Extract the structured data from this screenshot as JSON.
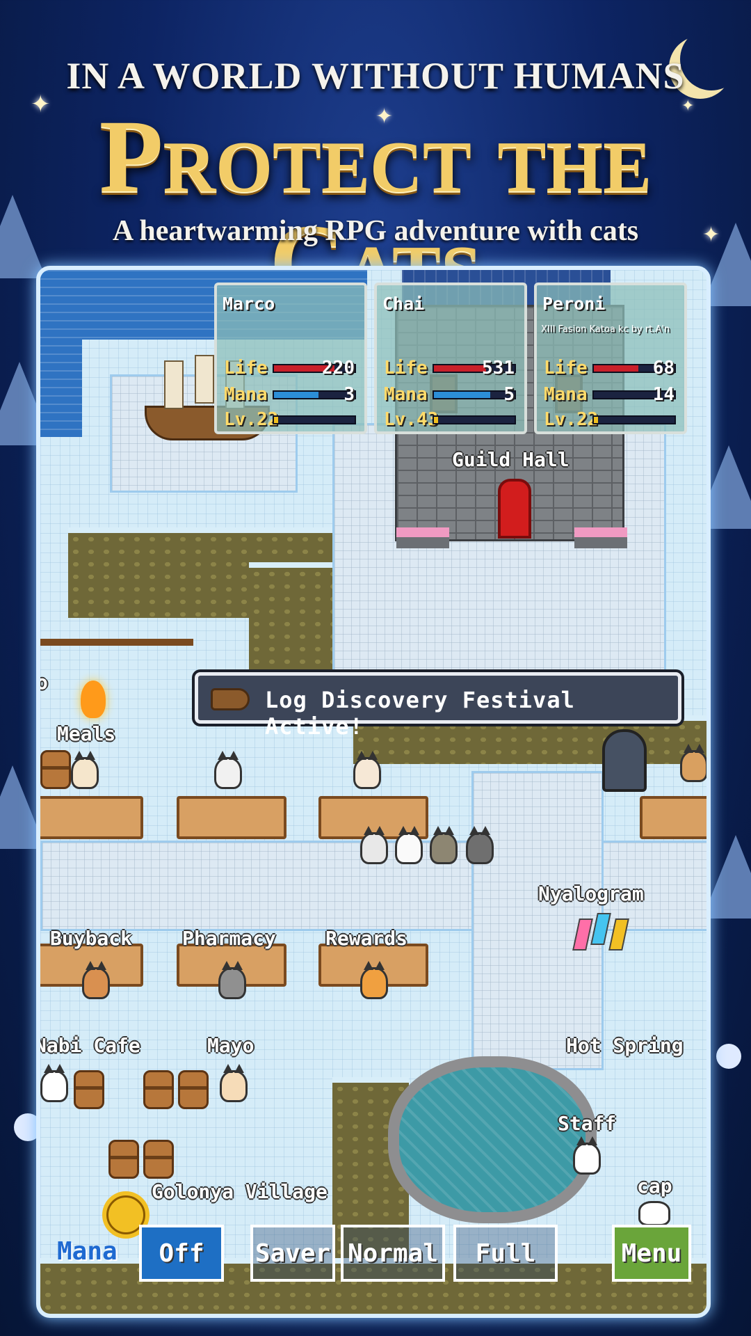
{
  "promo": {
    "headline": "IN A WORLD WITHOUT HUMANS",
    "title": "Protect the Cats",
    "subtitle": "A heartwarming RPG adventure with cats"
  },
  "party": [
    {
      "name": "Marco",
      "subtitle": "",
      "life": "220",
      "mana": "3",
      "level": "Lv.22",
      "life_pct": 0.75,
      "mana_pct": 0.55,
      "exp_pct": 0.05
    },
    {
      "name": "Chai",
      "subtitle": "",
      "life": "531",
      "mana": "5",
      "level": "Lv.43",
      "life_pct": 0.65,
      "mana_pct": 0.7,
      "exp_pct": 0.05
    },
    {
      "name": "Peroni",
      "subtitle": "XIII Fasion Katoa kc by rt.A'n",
      "life": "68",
      "mana": "14",
      "level": "Lv.22",
      "life_pct": 0.55,
      "mana_pct": 0.0,
      "exp_pct": 0.05
    }
  ],
  "stat_labels": {
    "life": "Life",
    "mana": "Mana"
  },
  "map": {
    "guild_hall": "Guild Hall",
    "meals": "Meals",
    "meals_partial": "o",
    "nyalogram": "Nyalogram",
    "buyback": "Buyback",
    "pharmacy": "Pharmacy",
    "rewards": "Rewards",
    "nabi_cafe": "Nabi Cafe",
    "mayo": "Mayo",
    "hot_spring": "Hot Spring",
    "staff": "Staff",
    "village": "Golonya Village",
    "cap": "cap"
  },
  "event_banner": "Log Discovery Festival Active!",
  "controls": {
    "label": "Mana",
    "off": "Off",
    "saver": "Saver",
    "normal": "Normal",
    "full": "Full",
    "menu": "Menu",
    "selected": "Off"
  },
  "colors": {
    "life_bar": "#c9202a",
    "mana_bar": "#2c8ed8",
    "exp_bar": "#f0c020",
    "accent_active": "#1e6fc4",
    "menu_green": "#6aa53a"
  }
}
